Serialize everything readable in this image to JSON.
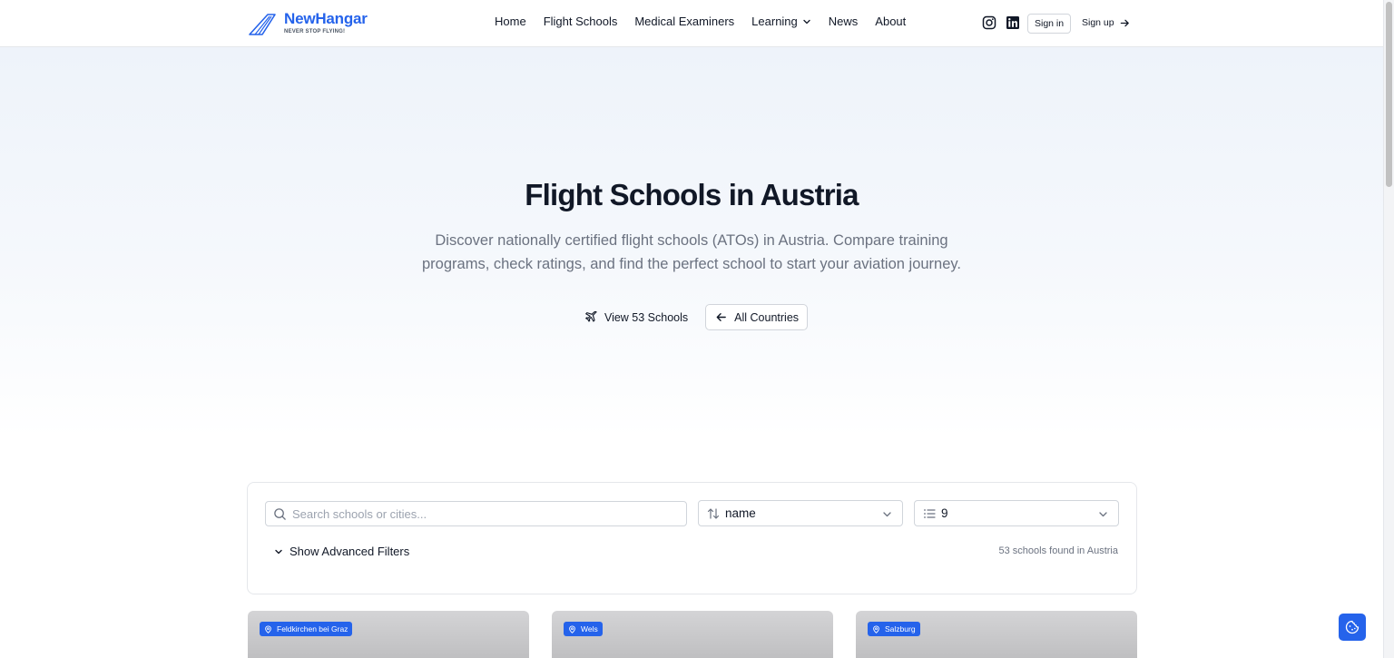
{
  "header": {
    "logo_name": "NewHangar",
    "logo_tagline": "NEVER STOP FLYING!",
    "nav": {
      "home": "Home",
      "flight_schools": "Flight Schools",
      "medical_examiners": "Medical Examiners",
      "learning": "Learning",
      "news": "News",
      "about": "About"
    },
    "social_icons": [
      "instagram-icon",
      "linkedin-icon"
    ],
    "sign_in": "Sign in",
    "sign_up": "Sign up"
  },
  "hero": {
    "title": "Flight Schools in Austria",
    "description": "Discover nationally certified flight schools (ATOs) in Austria. Compare training programs, check ratings, and find the perfect school to start your aviation journey.",
    "view_button": "View 53 Schools",
    "all_countries_button": "All Countries"
  },
  "filters": {
    "search_placeholder": "Search schools or cities...",
    "search_value": "",
    "sort_value": "name",
    "per_page_value": "9",
    "advanced_toggle": "Show Advanced Filters",
    "results_text": "53 schools found in Austria"
  },
  "cards": [
    {
      "location": "Feldkirchen bei Graz"
    },
    {
      "location": "Wels"
    },
    {
      "location": "Salzburg"
    }
  ],
  "colors": {
    "accent": "#2563eb",
    "text": "#111827",
    "muted": "#6b7280",
    "border": "#d1d5db"
  }
}
